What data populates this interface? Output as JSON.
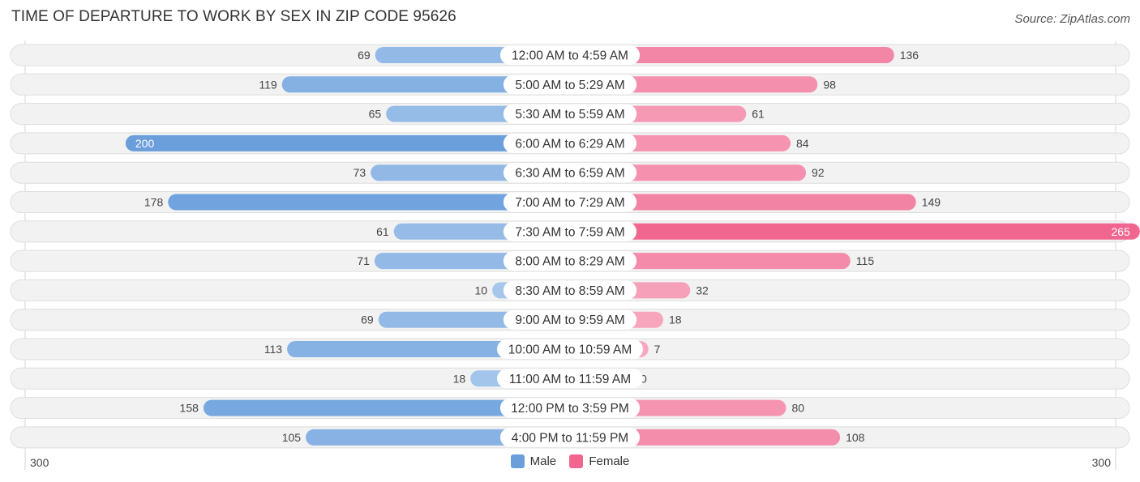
{
  "title": "TIME OF DEPARTURE TO WORK BY SEX IN ZIP CODE 95626",
  "source": "Source: ZipAtlas.com",
  "colors": {
    "male_strong": "#6a9fdc",
    "male_light": "#a9c8ec",
    "female_strong": "#f0668f",
    "female_light": "#f7a8c0",
    "track": "#f2f2f2",
    "track_border": "#dedede",
    "label_bg": "#ffffff"
  },
  "chart_data": {
    "type": "bar",
    "orientation": "horizontal-diverging",
    "title": "TIME OF DEPARTURE TO WORK BY SEX IN ZIP CODE 95626",
    "categories": [
      "12:00 AM to 4:59 AM",
      "5:00 AM to 5:29 AM",
      "5:30 AM to 5:59 AM",
      "6:00 AM to 6:29 AM",
      "6:30 AM to 6:59 AM",
      "7:00 AM to 7:29 AM",
      "7:30 AM to 7:59 AM",
      "8:00 AM to 8:29 AM",
      "8:30 AM to 8:59 AM",
      "9:00 AM to 9:59 AM",
      "10:00 AM to 10:59 AM",
      "11:00 AM to 11:59 AM",
      "12:00 PM to 3:59 PM",
      "4:00 PM to 11:59 PM"
    ],
    "series": [
      {
        "name": "Male",
        "values": [
          69,
          119,
          65,
          200,
          73,
          178,
          61,
          71,
          10,
          69,
          113,
          18,
          158,
          105
        ]
      },
      {
        "name": "Female",
        "values": [
          136,
          98,
          61,
          84,
          92,
          149,
          265,
          115,
          32,
          18,
          7,
          0,
          80,
          108
        ]
      }
    ],
    "axis": {
      "left_tick": "300",
      "right_tick": "300",
      "range": [
        300,
        300
      ]
    },
    "legend": {
      "position": "bottom-center",
      "entries": [
        "Male",
        "Female"
      ]
    },
    "grid": false
  }
}
